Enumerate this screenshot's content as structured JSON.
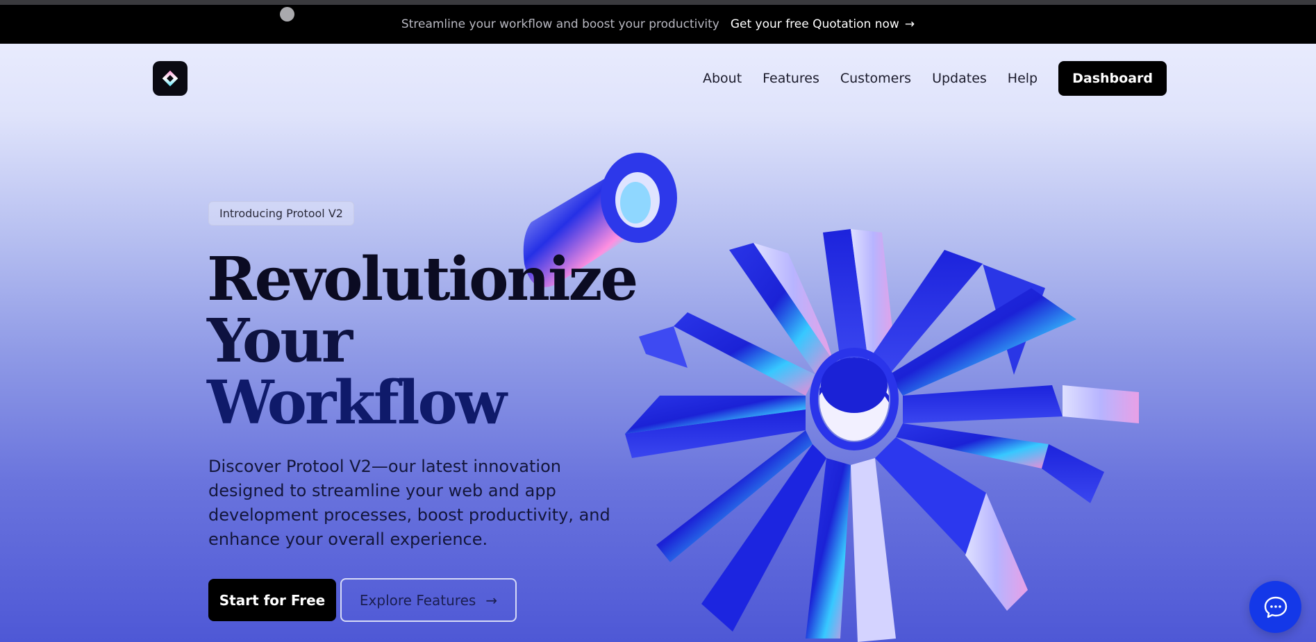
{
  "announcement": {
    "message": "Streamline your workflow and boost your productivity",
    "cta_label": "Get your free Quotation now",
    "cta_icon": "arrow-right-icon"
  },
  "nav": {
    "logo_icon": "diamond-logo-icon",
    "links": [
      "About",
      "Features",
      "Customers",
      "Updates",
      "Help"
    ],
    "dashboard_label": "Dashboard"
  },
  "hero": {
    "badge": "Introducing Protool V2",
    "headline": [
      "Revolutionize",
      "Your",
      "Workflow"
    ],
    "description": "Discover Protool V2—our latest innovation designed to streamline your web and app development processes, boost productivity, and enhance your overall experience.",
    "primary_button": "Start for Free",
    "secondary_button": "Explore Features",
    "secondary_icon": "arrow-right-icon"
  },
  "chat": {
    "icon": "chat-bubble-icon"
  },
  "colors": {
    "accent": "#1438e8",
    "announcement_bg": "#000000",
    "button_dark": "#000000"
  }
}
